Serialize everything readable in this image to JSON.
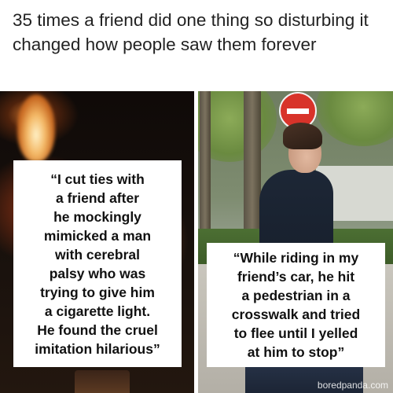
{
  "headline": "35 times a friend did one thing so disturbing it changed how people saw them forever",
  "left_panel": {
    "quote": "“I cut ties with\na friend after\nhe mockingly\nmimicked a man\nwith cerebral\npalsy who was\ntrying to give him\na cigarette light.\nHe found the cruel\nimitation hilarious”"
  },
  "right_panel": {
    "quote": "“While riding in my\nfriend’s car, he hit\na pedestrian in a\ncrosswalk and tried\nto flee until I yelled\nat him to stop”",
    "watermark": "boredpanda.com"
  },
  "icons": [
    "no-entry-sign-icon",
    "lighter-flame-icon"
  ],
  "colors": {
    "text": "#222222",
    "caption_bg": "#ffffff",
    "sign_red": "#d8332a"
  }
}
